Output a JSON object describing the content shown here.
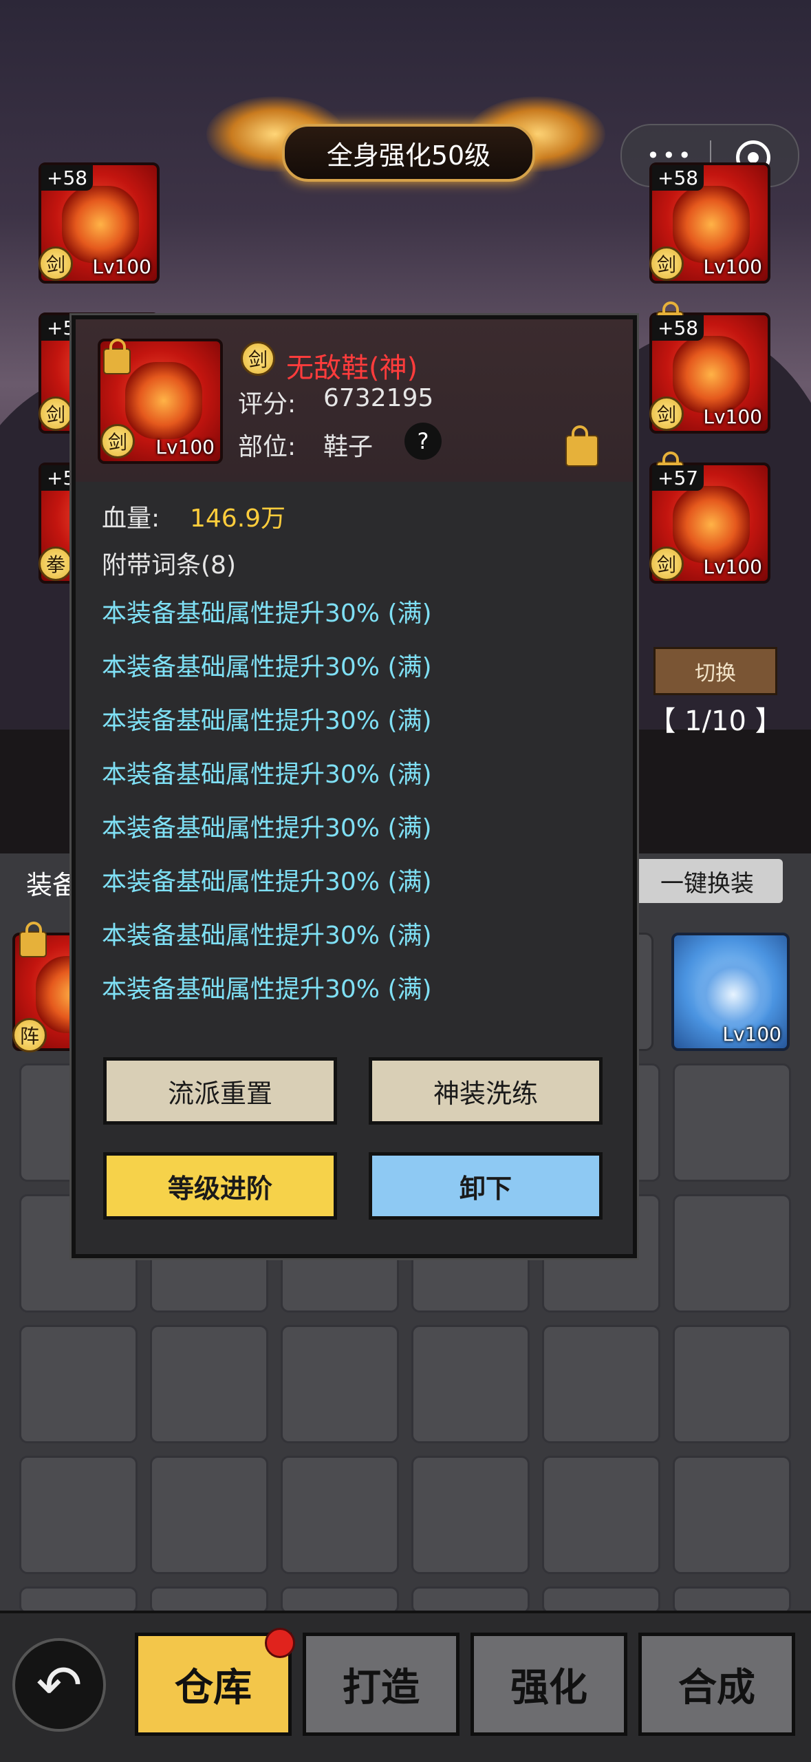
{
  "banner": {
    "title": "全身强化50级"
  },
  "capsule": {
    "dots": "•••"
  },
  "slots_left": [
    {
      "plus": "+58",
      "badge": "剑",
      "level": "Lv100"
    },
    {
      "plus": "+5",
      "badge": "剑",
      "level": ""
    },
    {
      "plus": "+5",
      "badge": "拳",
      "level": ""
    }
  ],
  "slots_right": [
    {
      "plus": "+58",
      "badge": "剑",
      "level": "Lv100"
    },
    {
      "plus": "+58",
      "badge": "剑",
      "level": "Lv100"
    },
    {
      "plus": "+57",
      "badge": "剑",
      "level": "Lv100"
    }
  ],
  "switch": {
    "label": "切换",
    "pager": "【 1/10 】"
  },
  "warehouse": {
    "equip_label": "装备",
    "onekey_label": "一键换装",
    "first_slot_badge": "阵",
    "last_slot_level": "Lv100"
  },
  "popup": {
    "item_badge": "剑",
    "item_name": "无敌鞋(神)",
    "tile_badge": "剑",
    "tile_level": "Lv100",
    "score_label": "评分:",
    "score_value": "6732195",
    "slot_label": "部位:",
    "slot_value": "鞋子",
    "help": "?",
    "hp_label": "血量:",
    "hp_value": "146.9万",
    "affix_title": "附带词条(8)",
    "affixes": [
      "本装备基础属性提升30% (满)",
      "本装备基础属性提升30% (满)",
      "本装备基础属性提升30% (满)",
      "本装备基础属性提升30% (满)",
      "本装备基础属性提升30% (满)",
      "本装备基础属性提升30% (满)",
      "本装备基础属性提升30% (满)",
      "本装备基础属性提升30% (满)"
    ],
    "buttons": {
      "reset": "流派重置",
      "refine": "神装洗练",
      "advance": "等级进阶",
      "unequip": "卸下"
    }
  },
  "bottom_tabs": [
    {
      "label": "仓库",
      "active": true,
      "notify": true
    },
    {
      "label": "打造",
      "active": false
    },
    {
      "label": "强化",
      "active": false
    },
    {
      "label": "合成",
      "active": false
    }
  ],
  "colors": {
    "item_name": "#ff3c3c",
    "hp_value": "#ffcd3c",
    "affix": "#7fe0f5",
    "active_tab": "#f3c64a"
  },
  "icons": {
    "back": "back-arrow-icon",
    "lock": "lock-icon",
    "help": "help-icon"
  }
}
